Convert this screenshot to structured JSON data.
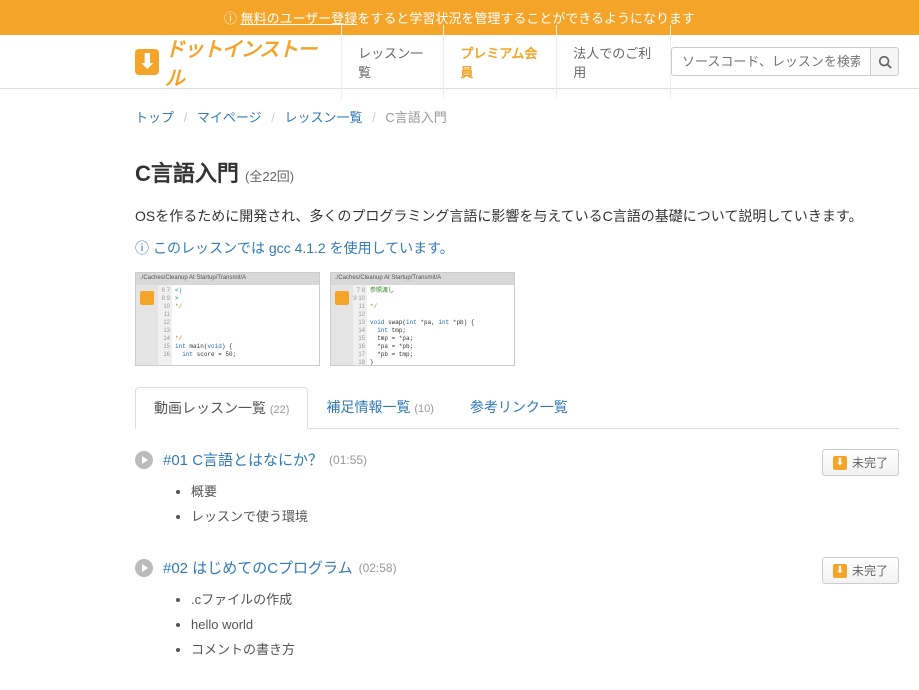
{
  "banner": {
    "prefix": "無料のユーザー登録",
    "suffix": "をすると学習状況を管理することができるようになります"
  },
  "logo": {
    "text": "ドットインストール"
  },
  "nav": {
    "lessons": "レッスン一覧",
    "premium": "プレミアム会員",
    "corporate": "法人でのご利用"
  },
  "search": {
    "placeholder": "ソースコード、レッスンを検索"
  },
  "breadcrumb": {
    "top": "トップ",
    "mypage": "マイページ",
    "lessons": "レッスン一覧",
    "current": "C言語入門"
  },
  "page": {
    "title": "C言語入門",
    "count": "(全22回)",
    "description": "OSを作るために開発され、多くのプログラミング言語に影響を与えているC言語の基礎について説明していきます。",
    "info": "このレッスンでは gcc 4.1.2 を使用しています。"
  },
  "thumbs": {
    "path": "./Caches/Cleanup At Startup/Transmit/A",
    "a": {
      "lines": "6\n7\n8\n9\n10\n11\n12\n13\n14\n15\n16",
      "code": "<|\n>\n*/\n\n\n\n\n*/\nint main(void) {\n  int score = 50;"
    },
    "b": {
      "lines": "7\n8\n9\n10\n11\n12\n13\n14\n15\n16\n17\n18",
      "code": "参照渡し\n\n*/\n\nvoid swap(int *pa, int *pb) {\n  int tmp;\n  tmp = *pa;\n  *pa = *pb;\n  *pb = tmp;\n}\n"
    }
  },
  "tabs": {
    "videos": "動画レッスン一覧",
    "videos_count": "(22)",
    "notes": "補足情報一覧",
    "notes_count": "(10)",
    "links": "参考リンク一覧"
  },
  "lessons": [
    {
      "title": "#01 C言語とはなにか？",
      "duration": "(01:55)",
      "points": [
        "概要",
        "レッスンで使う環境"
      ],
      "status": "未完了"
    },
    {
      "title": "#02 はじめてのCプログラム",
      "duration": "(02:58)",
      "points": [
        ".cファイルの作成",
        "hello world",
        "コメントの書き方"
      ],
      "status": "未完了"
    }
  ]
}
